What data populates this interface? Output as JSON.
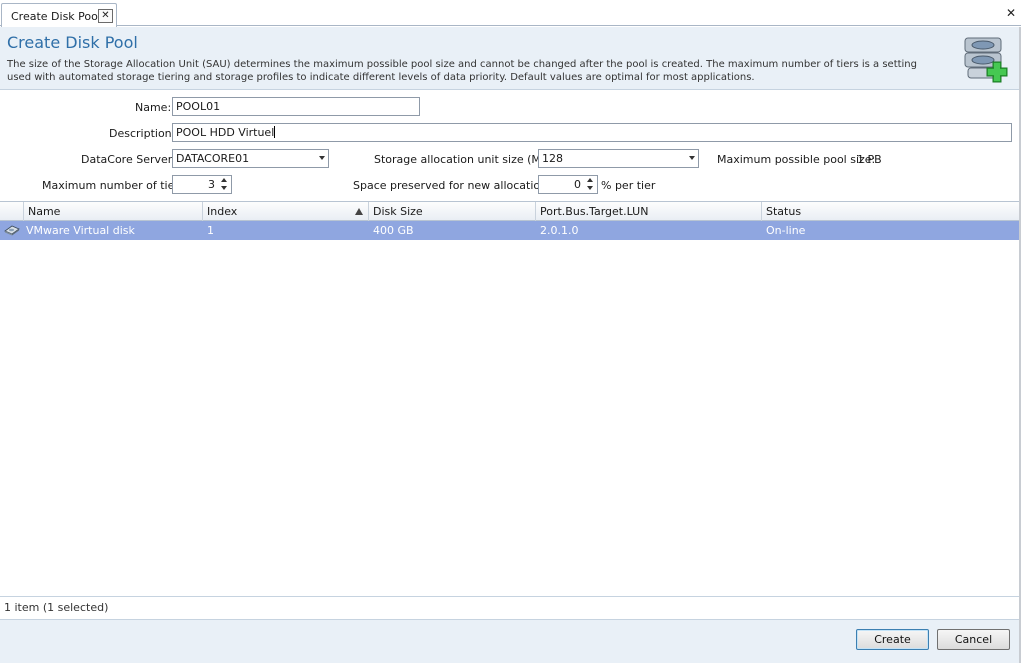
{
  "tab": {
    "label": "Create Disk Pool",
    "close_glyph": "✕"
  },
  "window": {
    "close_glyph": "✕"
  },
  "header": {
    "title": "Create Disk Pool",
    "description": "The size of the Storage Allocation Unit (SAU) determines the maximum possible pool size and cannot be changed after the pool is created. The maximum number of tiers is a setting used with automated storage tiering and storage profiles to indicate different levels of data priority. Default values are  optimal for most applications.",
    "icon": "disk-pool-add-icon"
  },
  "form": {
    "name_label": "Name:",
    "name_value": "POOL01",
    "description_label": "Description:",
    "description_value": "POOL HDD Virtuel",
    "server_label": "DataCore Server:",
    "server_value": "DATACORE01",
    "sau_label": "Storage allocation unit size (MB):",
    "sau_value": "128",
    "max_pool_label": "Maximum possible pool size:",
    "max_pool_value": "1 PB",
    "tiers_label": "Maximum number of tiers:",
    "tiers_value": "3",
    "space_label": "Space preserved for new allocations:",
    "space_value": "0",
    "space_unit": "% per tier"
  },
  "grid": {
    "columns": [
      "Name",
      "Index",
      "Disk Size",
      "Port.Bus.Target.LUN",
      "Status"
    ],
    "rows": [
      {
        "icon": "virtual-disk-icon",
        "name": "VMware Virtual disk",
        "index": "1",
        "disk_size": "400 GB",
        "location": "2.0.1.0",
        "status": "On-line"
      }
    ],
    "selected_color": "#8fa6e0"
  },
  "status": {
    "text": "1 item (1 selected)"
  },
  "buttons": {
    "create": "Create",
    "cancel": "Cancel"
  },
  "colors": {
    "title": "#2f6fa8",
    "banner_bg": "#e9f0f7"
  }
}
